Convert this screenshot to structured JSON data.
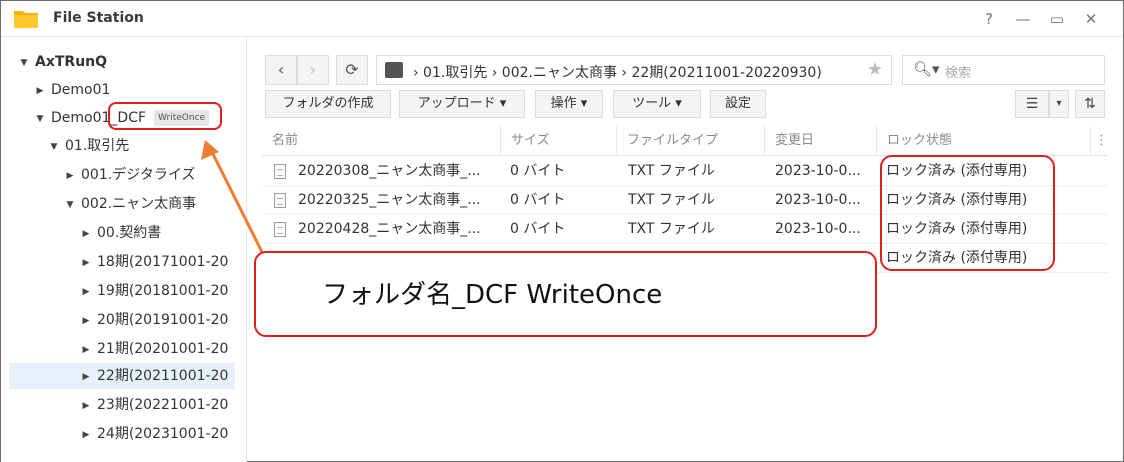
{
  "app": {
    "title": "File Station"
  },
  "window_controls": {
    "help": "?",
    "minimize": "—",
    "maximize": "▭",
    "close": "✕"
  },
  "sidebar": {
    "root": "AxTRunQ",
    "items": [
      {
        "label": "Demo01"
      },
      {
        "label": "Demo01_DCF",
        "badge": "WriteOnce"
      },
      {
        "label": "01.取引先"
      },
      {
        "label": "001.デジタライズ"
      },
      {
        "label": "002.ニャン太商事"
      },
      {
        "label": "00.契約書"
      },
      {
        "label": "18期(20171001-20"
      },
      {
        "label": "19期(20181001-20"
      },
      {
        "label": "20期(20191001-20"
      },
      {
        "label": "21期(20201001-20"
      },
      {
        "label": "22期(20211001-20"
      },
      {
        "label": "23期(20221001-20"
      },
      {
        "label": "24期(20231001-20"
      }
    ]
  },
  "toolbar": {
    "back": "‹",
    "forward": "›",
    "refresh": "⟳",
    "path": "› 01.取引先 › 002.ニャン太商事 › 22期(20211001-20220930)",
    "star": "★",
    "search_placeholder": "検索",
    "create_folder": "フォルダの作成",
    "upload": "アップロード ▾",
    "action": "操作 ▾",
    "tools": "ツール ▾",
    "settings": "設定",
    "list_view": "☰",
    "dropdown": "▾",
    "sort": "⇅"
  },
  "table": {
    "columns": [
      "名前",
      "サイズ",
      "ファイルタイプ",
      "変更日",
      "ロック状態"
    ],
    "rows": [
      {
        "name": "20220308_ニャン太商事_...",
        "size": "0 バイト",
        "type": "TXT ファイル",
        "modified": "2023-10-0...",
        "lock": "ロック済み (添付専用)"
      },
      {
        "name": "20220325_ニャン太商事_...",
        "size": "0 バイト",
        "type": "TXT ファイル",
        "modified": "2023-10-0...",
        "lock": "ロック済み (添付専用)"
      },
      {
        "name": "20220428_ニャン太商事_...",
        "size": "0 バイト",
        "type": "TXT ファイル",
        "modified": "2023-10-0...",
        "lock": "ロック済み (添付専用)"
      },
      {
        "name": "",
        "size": "",
        "type": "",
        "modified": "",
        "lock": "ロック済み (添付専用)"
      }
    ]
  },
  "annotation": {
    "text": "フォルダ名_DCF WriteOnce"
  },
  "colors": {
    "annotation_red": "#e01e1e",
    "arrow_orange": "#ed7d31",
    "selected_row": "#e8f1fb"
  }
}
